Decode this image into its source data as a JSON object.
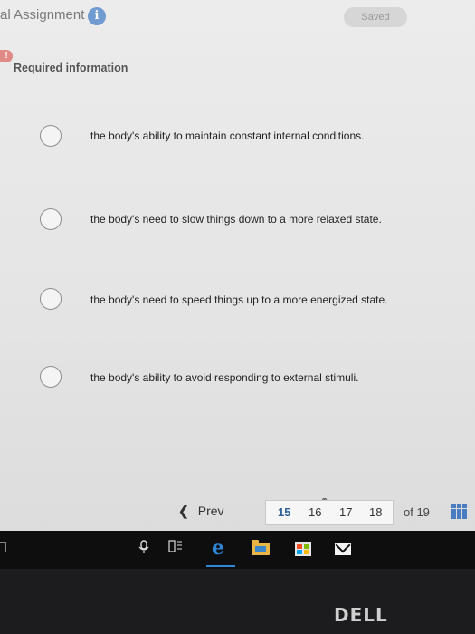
{
  "header": {
    "title": "al Assignment",
    "info_icon": "i",
    "saved_label": "Saved"
  },
  "question": {
    "alert_icon": "!",
    "required_info": "Required information",
    "options": [
      {
        "label": "the body's ability to maintain constant internal conditions."
      },
      {
        "label": "the body's need to slow things down to a more relaxed state."
      },
      {
        "label": "the body's need to speed things up to a more energized state."
      },
      {
        "label": "the body's ability to avoid responding to external stimuli."
      }
    ]
  },
  "pager": {
    "prev_icon": "❮",
    "prev_label": "Prev",
    "pages": [
      "15",
      "16",
      "17",
      "18"
    ],
    "current_page": "15",
    "of_label": "of 19",
    "link_icon": "⚭"
  },
  "taskbar": {
    "icons": [
      "microphone-icon",
      "task-view-icon",
      "edge-browser-icon",
      "file-explorer-icon",
      "store-icon",
      "mail-icon"
    ],
    "edge_glyph": "e"
  },
  "hardware": {
    "brand": "DELL"
  },
  "colors": {
    "accent": "#2b5f99",
    "info": "#6f9bd0",
    "alert": "#e08a86",
    "edge": "#2f86d6"
  }
}
